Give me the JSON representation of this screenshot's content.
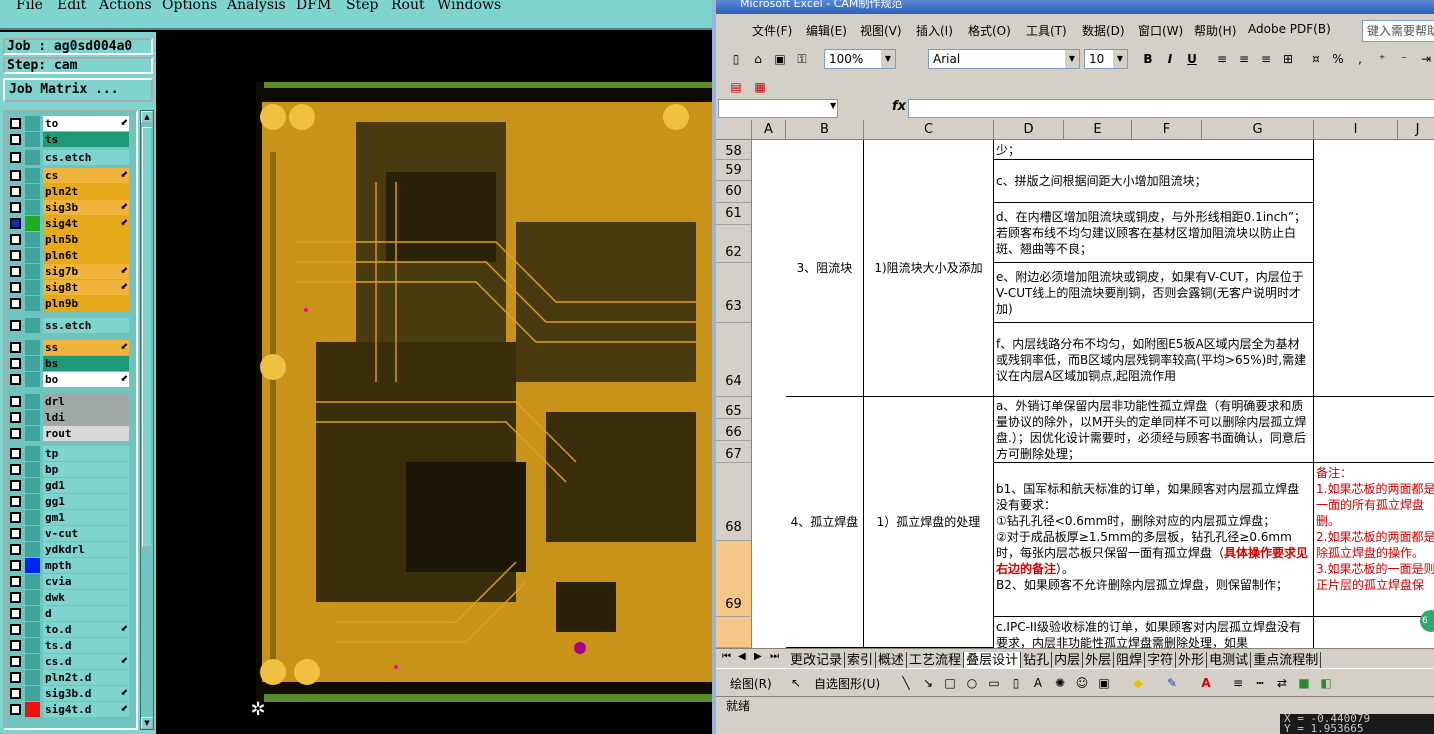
{
  "cam": {
    "menu": [
      "File",
      "Edit",
      "Actions",
      "Options",
      "Analysis",
      "DFM",
      "Step",
      "Rout",
      "Windows"
    ],
    "job_line": "Job : ag0sd004a0",
    "step_line": "Step: cam",
    "matrix_button": "Job Matrix ...",
    "layers": [
      {
        "name": "to",
        "color": "#ffffff",
        "arrow": true
      },
      {
        "name": "ts",
        "color": "#1f9a78",
        "arrow": false
      },
      {
        "name": "cs.etch",
        "color": "#7fd4d0",
        "arrow": false
      },
      {
        "name": "cs",
        "color": "#f0b43c",
        "arrow": true
      },
      {
        "name": "pln2t",
        "color": "#e6a91a",
        "arrow": false
      },
      {
        "name": "sig3b",
        "color": "#f0b43c",
        "arrow": true
      },
      {
        "name": "sig4t",
        "color": "#e6a91a",
        "arrow": true,
        "active": true
      },
      {
        "name": "pln5b",
        "color": "#e6a91a",
        "arrow": false
      },
      {
        "name": "pln6t",
        "color": "#e6a91a",
        "arrow": false
      },
      {
        "name": "sig7b",
        "color": "#f0b43c",
        "arrow": true
      },
      {
        "name": "sig8t",
        "color": "#f0b43c",
        "arrow": true
      },
      {
        "name": "pln9b",
        "color": "#e6a91a",
        "arrow": false
      },
      {
        "name": "ss.etch",
        "color": "#7fd4d0",
        "arrow": false
      },
      {
        "name": "ss",
        "color": "#f0b43c",
        "arrow": true
      },
      {
        "name": "bs",
        "color": "#1f9a78",
        "arrow": false
      },
      {
        "name": "bo",
        "color": "#ffffff",
        "arrow": true
      },
      {
        "name": "drl",
        "color": "#a0a8a8",
        "arrow": false
      },
      {
        "name": "ldi",
        "color": "#a0a8a8",
        "arrow": false
      },
      {
        "name": "rout",
        "color": "#d8d8d8",
        "arrow": false
      },
      {
        "name": "tp",
        "color": "#7fd4d0",
        "arrow": false
      },
      {
        "name": "bp",
        "color": "#7fd4d0",
        "arrow": false
      },
      {
        "name": "gd1",
        "color": "#7fd4d0",
        "arrow": false
      },
      {
        "name": "gg1",
        "color": "#7fd4d0",
        "arrow": false
      },
      {
        "name": "gm1",
        "color": "#7fd4d0",
        "arrow": false
      },
      {
        "name": "v-cut",
        "color": "#7fd4d0",
        "arrow": false
      },
      {
        "name": "ydkdrl",
        "color": "#7fd4d0",
        "arrow": false
      },
      {
        "name": "mpth",
        "color": "#7fd4d0",
        "arrow": false
      },
      {
        "name": "cvia",
        "color": "#7fd4d0",
        "arrow": false
      },
      {
        "name": "dwk",
        "color": "#7fd4d0",
        "arrow": false
      },
      {
        "name": "d",
        "color": "#7fd4d0",
        "arrow": false
      },
      {
        "name": "to.d",
        "color": "#7fd4d0",
        "arrow": true
      },
      {
        "name": "ts.d",
        "color": "#7fd4d0",
        "arrow": false
      },
      {
        "name": "cs.d",
        "color": "#7fd4d0",
        "arrow": true
      },
      {
        "name": "pln2t.d",
        "color": "#7fd4d0",
        "arrow": false
      },
      {
        "name": "sig3b.d",
        "color": "#7fd4d0",
        "arrow": true
      },
      {
        "name": "sig4t.d",
        "color": "#7fd4d0",
        "arrow": true
      }
    ],
    "palette_colors": {
      "sig4t": "#22aa22",
      "mpth": "#0022ff",
      "sig4t.d": "#ee1111"
    },
    "coords_x": "X = -0.440079",
    "coords_y": "Y = 1.953665"
  },
  "excel": {
    "title": "Microsoft Excel - CAM制作规范",
    "menu": [
      "文件(F)",
      "编辑(E)",
      "视图(V)",
      "插入(I)",
      "格式(O)",
      "工具(T)",
      "数据(D)",
      "窗口(W)",
      "帮助(H)",
      "Adobe PDF(B)"
    ],
    "help_placeholder": "键入需要帮助",
    "zoom": "100%",
    "font": "Arial",
    "font_size": "10",
    "columns": [
      "A",
      "B",
      "C",
      "D",
      "E",
      "F",
      "G",
      "I",
      "J"
    ],
    "rows": [
      "58",
      "59",
      "60",
      "61",
      "62",
      "63",
      "64",
      "65",
      "66",
      "67",
      "68",
      "69"
    ],
    "cells": {
      "d58": "少；",
      "d59": "c、拼版之间根据间距大小增加阻流块；",
      "d61": "d、在内槽区增加阻流块或铜皮，与外形线相距0.1inch”；若顾客布线不均匀建议顾客在基材区增加阻流块以防止白斑、翘曲等不良；",
      "b_flow": "3、阻流块",
      "c_flow": "1)阻流块大小及添加",
      "d63": "e、附边必须增加阻流块或铜皮，如果有V-CUT，内层位于V-CUT线上的阻流块要削铜，否则会露铜(无客户说明时才加)",
      "d64": "f、内层线路分布不均匀，如附图E5板A区域内层全为基材或残铜率低，而B区域内层残铜率较高(平均>65%)时,需建议在内层A区域加铜点,起阻流作用",
      "d65": "a、外销订单保留内层非功能性孤立焊盘（有明确要求和质量协议的除外，以M开头的定单同样不可以删除内层孤立焊盘.）；因优化设计需要时，必须经与顾客书面确认，同意后方可删除处理；",
      "b_pad": "4、孤立焊盘",
      "c_pad": "1）孤立焊盘的处理",
      "d68_a": "b1、国军标和航天标准的订单，如果顾客对内层孤立焊盘没有要求：",
      "d68_b": "①钻孔孔径<0.6mm时，删除对应的内层孤立焊盘；",
      "d68_c": "②对于成品板厚≥1.5mm的多层板，钻孔孔径≥0.6mm时，每张内层芯板只保留一面有孤立焊盘（",
      "d68_d": "具体操作要求见右边的备注",
      "d68_e": "）。",
      "d68_f": "B2、如果顾客不允许删除内层孤立焊盘，则保留制作；",
      "d70": "c.IPC-II级验收标准的订单，如果顾客对内层孤立焊盘没有要求，内层非功能性孤立焊盘需删除处理，如果",
      "note_title": "备注：",
      "note1": "1.如果芯板的两面都是一面的所有孤立焊盘删。",
      "note2": "2.如果芯板的两面都是除孤立焊盘的操作。",
      "note3": "3.如果芯板的一面是则正片层的孤立焊盘保"
    },
    "sheet_tabs": [
      "更改记录",
      "索引",
      "概述",
      "工艺流程",
      "叠层设计",
      "钻孔",
      "内层",
      "外层",
      "阻焊",
      "字符",
      "外形",
      "电测试",
      "重点流程制"
    ],
    "draw_label": "绘图(R)",
    "autoshape_label": "自选图形(U)",
    "status": "就绪",
    "badge": "6"
  }
}
